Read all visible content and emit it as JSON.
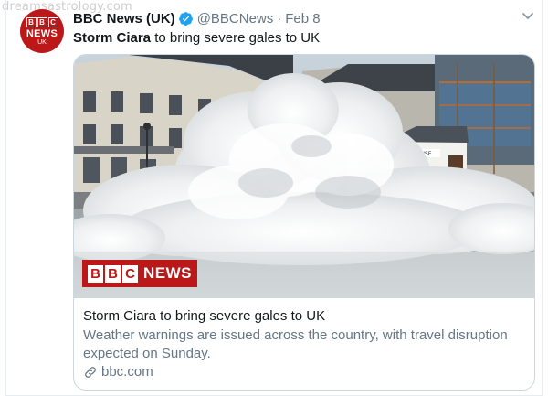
{
  "watermark": "dreamsastrology.com",
  "tweet": {
    "avatar": {
      "blocks": [
        "B",
        "B",
        "C"
      ],
      "word": "NEWS",
      "region": "UK"
    },
    "display_name": "BBC News (UK)",
    "handle": "@BBCNews",
    "separator": "·",
    "date": "Feb 8",
    "text_bold": "Storm Ciara",
    "text_rest": " to bring severe gales to UK",
    "icons": {
      "verified": "verified-badge-icon",
      "menu": "chevron-down-icon",
      "link": "link-icon"
    }
  },
  "card": {
    "badge": {
      "blocks": [
        "B",
        "B",
        "C"
      ],
      "word": "NEWS"
    },
    "title": "Storm Ciara to bring severe gales to UK",
    "description": "Weather warnings are issued across the country, with travel disruption expected on Sunday.",
    "domain": "bbc.com",
    "sign_text": "BOATHOUSE"
  },
  "colors": {
    "bbc_red": "#bb1919",
    "verified_blue": "#1da1f2",
    "muted": "#657786"
  }
}
